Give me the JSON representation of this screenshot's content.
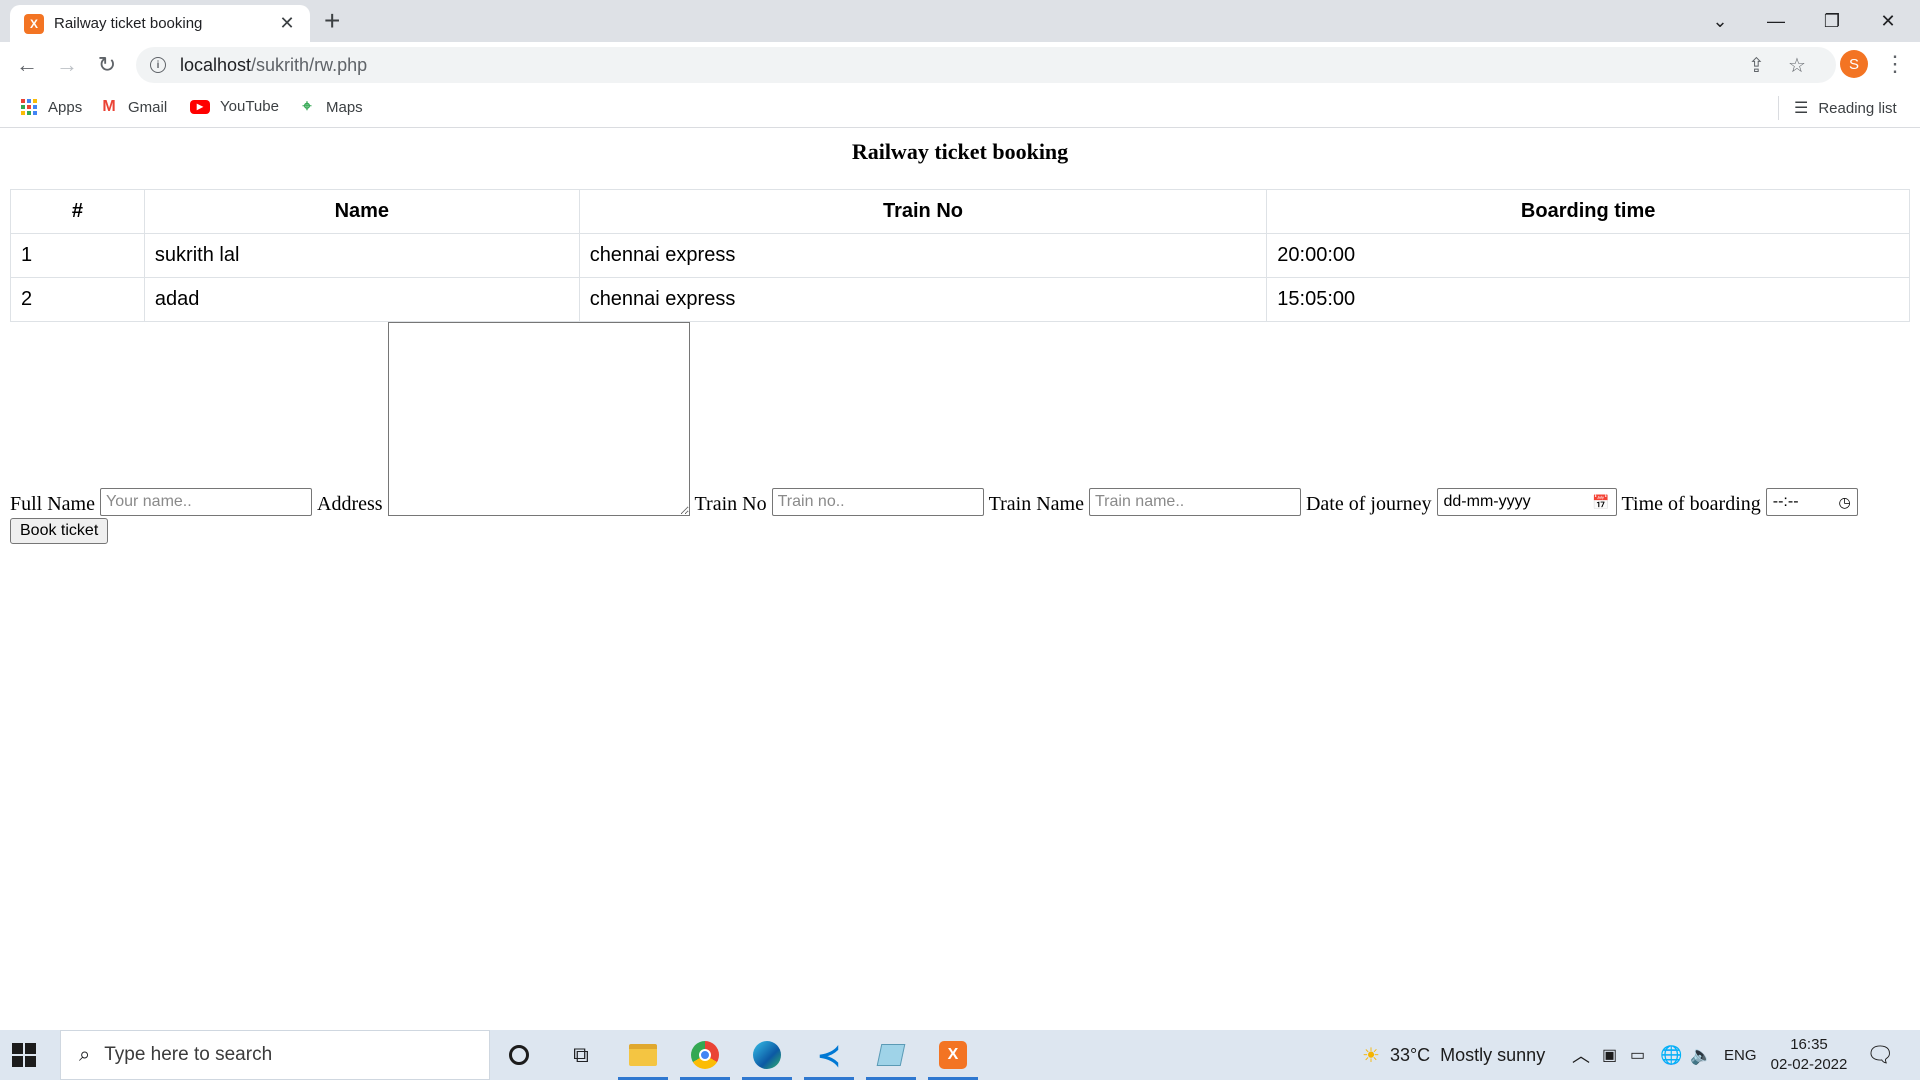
{
  "browser": {
    "tab_title": "Railway ticket booking",
    "tab_favicon_icon": "xampp-icon",
    "new_tab_label": "+",
    "url_host": "localhost",
    "url_path": "/sukrith/rw.php",
    "profile_initial": "S"
  },
  "bookmarks": {
    "apps": "Apps",
    "gmail": "Gmail",
    "youtube": "YouTube",
    "maps": "Maps",
    "reading_list": "Reading list"
  },
  "page": {
    "title": "Railway ticket booking",
    "table": {
      "headers": [
        "#",
        "Name",
        "Train No",
        "Boarding time"
      ],
      "rows": [
        [
          "1",
          "sukrith lal",
          "chennai express",
          "20:00:00"
        ],
        [
          "2",
          "adad",
          "chennai express",
          "15:05:00"
        ]
      ]
    },
    "form": {
      "full_name_label": "Full Name",
      "full_name_placeholder": "Your name..",
      "address_label": "Address",
      "train_no_label": "Train No",
      "train_no_placeholder": "Train no..",
      "train_name_label": "Train Name",
      "train_name_placeholder": "Train name..",
      "date_label": "Date of journey",
      "date_placeholder": "dd-mm-yyyy",
      "time_label": "Time of boarding",
      "time_placeholder": "--:--",
      "submit_label": "Book ticket"
    }
  },
  "taskbar": {
    "search_placeholder": "Type here to search",
    "weather": "33°C  Mostly sunny",
    "language": "ENG",
    "time": "16:35",
    "date": "02-02-2022"
  },
  "colors": {
    "accent_orange": "#f37423",
    "tabstrip_bg": "#dee1e6",
    "taskbar_bg": "#dde6f0"
  }
}
